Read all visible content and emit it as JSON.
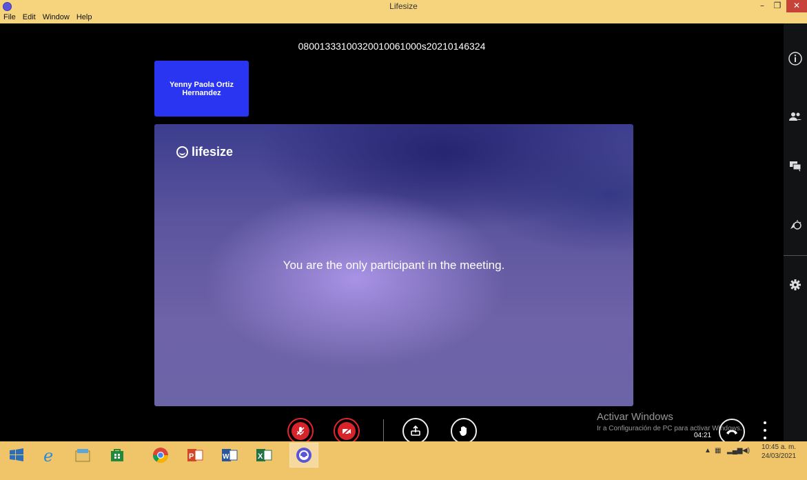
{
  "window": {
    "title": "Lifesize",
    "minimize": "–",
    "maximize": "❐",
    "close": "✕"
  },
  "menu": [
    "File",
    "Edit",
    "Window",
    "Help"
  ],
  "meeting": {
    "id": "080013331003200100610​00s20210146324",
    "participant_name": "Yenny Paola Ortiz Hernandez",
    "logo_text": "lifesize",
    "only_participant_message": "You are the only participant in the meeting.",
    "elapsed": "04:21"
  },
  "watermark": {
    "line1": "Activar Windows",
    "line2": "Ir a Configuración de PC para activar Windows."
  },
  "controls": {
    "mic": "mic-muted-icon",
    "camera": "camera-off-icon",
    "share": "share-screen-icon",
    "raise_hand": "raise-hand-icon",
    "hangup": "hangup-icon",
    "more": "more-vertical-icon"
  },
  "rail": [
    "info-icon",
    "participants-icon",
    "chat-icon",
    "reactions-icon",
    "settings-icon"
  ],
  "taskbar": {
    "apps": [
      "windows-start-icon",
      "internet-explorer-icon",
      "file-explorer-icon",
      "store-icon",
      "chrome-icon",
      "powerpoint-icon",
      "word-icon",
      "excel-icon",
      "lifesize-icon"
    ],
    "clock_time": "10:45 a. m.",
    "clock_date": "24/03/2021"
  },
  "colors": {
    "titlebar": "#f6d47e",
    "participant_tile": "#2a35f2",
    "control_red": "#e2262b",
    "taskbar": "#f0c56a"
  }
}
